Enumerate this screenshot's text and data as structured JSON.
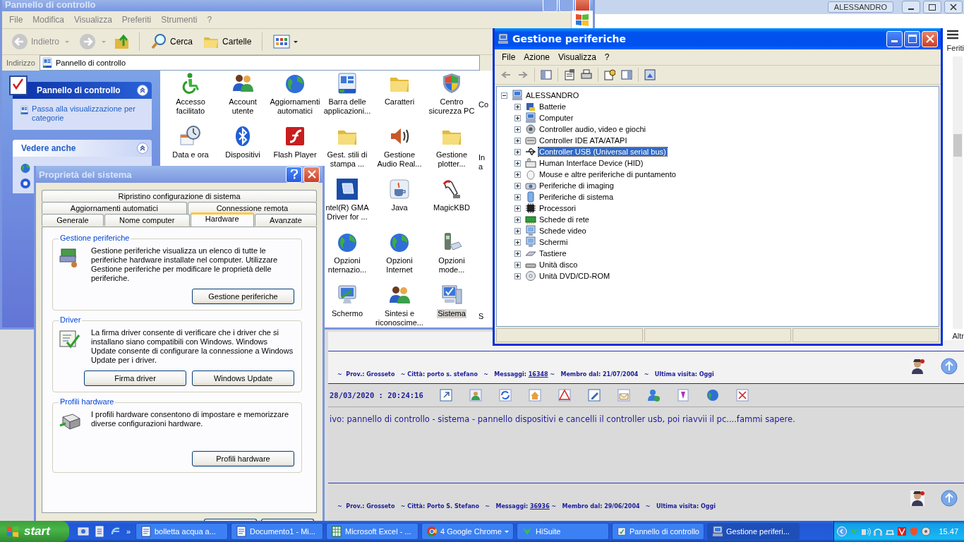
{
  "browser": {
    "user": "ALESSANDRO",
    "side_label": "Feriti",
    "side_label_bottom": "Altr"
  },
  "control_panel": {
    "title": "Pannello di controllo",
    "menu": [
      "File",
      "Modifica",
      "Visualizza",
      "Preferiti",
      "Strumenti",
      "?"
    ],
    "back": {
      "label": "Indietro",
      "disabled": true
    },
    "forward": {
      "disabled": true
    },
    "search": "Cerca",
    "folders": "Cartelle",
    "address": {
      "label": "Indirizzo",
      "value": "Pannello di controllo"
    },
    "task_panels": [
      {
        "title": "Pannello di controllo",
        "kind": "primary",
        "expanded": true,
        "links": [
          "Passa alla visualizzazione per categorie"
        ]
      },
      {
        "title": "Vedere anche",
        "kind": "secondary",
        "expanded": true
      }
    ],
    "icon_rows": [
      [
        {
          "kind": "icon",
          "label": "Accesso facilitato",
          "selected": false
        },
        {
          "kind": "icon",
          "label": "Account utente",
          "selected": false
        },
        {
          "kind": "icon",
          "label": "Aggiornamenti automatici",
          "selected": false
        },
        {
          "kind": "icon",
          "label": "Barra delle applicazioni...",
          "selected": false
        },
        {
          "kind": "icon",
          "label": "Caratteri",
          "selected": false
        },
        {
          "kind": "icon",
          "label": "Centro sicurezza PC",
          "selected": false
        },
        {
          "kind": "partial",
          "label": "Co",
          "selected": false
        }
      ],
      [
        {
          "kind": "icon",
          "label": "Data e ora",
          "selected": false
        },
        {
          "kind": "icon",
          "label": "Dispositivi",
          "selected": false
        },
        {
          "kind": "icon",
          "label": "Flash Player",
          "selected": false
        },
        {
          "kind": "icon",
          "label": "Gest. stili di stampa ...",
          "selected": false
        },
        {
          "kind": "icon",
          "label": "Gestione Audio Real...",
          "selected": false
        },
        {
          "kind": "icon",
          "label": "Gestione plotter...",
          "selected": false
        },
        {
          "kind": "partial",
          "label": "In a",
          "selected": false
        }
      ],
      [
        {
          "kind": "icon",
          "label": "ntel(R) GMA Driver for ...",
          "selected": false
        },
        {
          "kind": "icon",
          "label": "Java",
          "selected": false
        },
        {
          "kind": "icon",
          "label": "MagicKBD",
          "selected": false
        }
      ],
      [
        {
          "kind": "icon",
          "label": "Opzioni nternazio...",
          "selected": false
        },
        {
          "kind": "icon",
          "label": "Opzioni Internet",
          "selected": false
        },
        {
          "kind": "icon",
          "label": "Opzioni mode...",
          "selected": false
        }
      ],
      [
        {
          "kind": "icon",
          "label": "Schermo",
          "selected": false
        },
        {
          "kind": "icon",
          "label": "Sintesi e riconoscime...",
          "selected": false
        },
        {
          "kind": "icon",
          "label": "Sistema",
          "selected": true
        },
        {
          "kind": "partial",
          "label": "S",
          "selected": false
        }
      ]
    ]
  },
  "system_properties": {
    "title": "Proprietà del sistema",
    "tab_rows": [
      [
        {
          "label": "Ripristino configurazione di sistema",
          "selected": false
        }
      ],
      [
        {
          "label": "Aggiornamenti automatici",
          "selected": false
        },
        {
          "label": "Connessione remota",
          "selected": false
        }
      ],
      [
        {
          "label": "Generale",
          "selected": false
        },
        {
          "label": "Nome computer",
          "selected": false
        },
        {
          "label": "Hardware",
          "selected": true
        },
        {
          "label": "Avanzate",
          "selected": false
        }
      ]
    ],
    "groups": [
      {
        "kind": "devices",
        "title": "Gestione periferiche",
        "text": "Gestione periferiche visualizza un elenco di tutte le periferiche hardware installate nel computer. Utilizzare Gestione periferiche per modificare le proprietà delle periferiche.",
        "buttons": [
          "Gestione periferiche"
        ]
      },
      {
        "kind": "driver",
        "title": "Driver",
        "text": "La firma driver consente di verificare che i driver che si installano siano compatibili con Windows. Windows Update consente di configurare la connessione a Windows Update per i driver.",
        "buttons": [
          "Firma driver",
          "Windows Update"
        ]
      },
      {
        "kind": "profiles",
        "title": "Profili hardware",
        "text": "I profili hardware consentono di impostare e memorizzare diverse configurazioni hardware.",
        "buttons": [
          "Profili hardware"
        ]
      }
    ]
  },
  "device_manager": {
    "title": "Gestione periferiche",
    "menu": [
      "File",
      "Azione",
      "Visualizza",
      "?"
    ],
    "tree": {
      "label": "ALESSANDRO",
      "expanded": true,
      "children": [
        {
          "label": "Batterie",
          "expanded": false,
          "selected": false
        },
        {
          "label": "Computer",
          "expanded": false,
          "selected": false
        },
        {
          "label": "Controller audio, video e giochi",
          "expanded": false,
          "selected": false
        },
        {
          "label": "Controller IDE ATA/ATAPI",
          "expanded": false,
          "selected": false
        },
        {
          "label": "Controller USB (Universal serial bus)",
          "expanded": false,
          "selected": true
        },
        {
          "label": "Human Interface Device (HID)",
          "expanded": false,
          "selected": false
        },
        {
          "label": "Mouse e altre periferiche di puntamento",
          "expanded": false,
          "selected": false
        },
        {
          "label": "Periferiche di imaging",
          "expanded": false,
          "selected": false
        },
        {
          "label": "Periferiche di sistema",
          "expanded": false,
          "selected": false
        },
        {
          "label": "Processori",
          "expanded": false,
          "selected": false
        },
        {
          "label": "Schede di rete",
          "expanded": false,
          "selected": false
        },
        {
          "label": "Schede video",
          "expanded": false,
          "selected": false
        },
        {
          "label": "Schermi",
          "expanded": false,
          "selected": false
        },
        {
          "label": "Tastiere",
          "expanded": false,
          "selected": false
        },
        {
          "label": "Unità disco",
          "expanded": false,
          "selected": false
        },
        {
          "label": "Unità DVD/CD-ROM",
          "expanded": false,
          "selected": false
        }
      ]
    }
  },
  "forum": {
    "profile_lines": [
      {
        "before": "~  Prov.: Grosseto   ~ Città: porto s. stefano   ~   Messaggi:",
        "count": "16348",
        "after": "~   Membro dal: 21/07/2004   ~   Ultima visita: Oggi"
      },
      {
        "before": "~  Prov.: Grosseto   ~ Città: Porto S. Stefano   ~   Messaggi:",
        "count": "36936",
        "after": "~   Membro dal: 29/06/2004   ~   Ultima visita: Oggi"
      }
    ],
    "date": "28/03/2020 : 20:24:16",
    "message": "ivo: pannello di controllo - sistema - pannello dispositivi e cancelli il controller usb, poi riavvii il pc....fammi sapere."
  },
  "taskbar": {
    "start": "start",
    "more": "»",
    "tasks": [
      {
        "kind": "document",
        "label": "bolletta acqua a...",
        "selected": false
      },
      {
        "kind": "document",
        "label": "Documento1 - Mi...",
        "selected": false
      },
      {
        "kind": "spreadsheet",
        "label": "Microsoft Excel - ...",
        "selected": false
      },
      {
        "kind": "browser",
        "label": "4 Google Chrome",
        "selected": false
      },
      {
        "kind": "app",
        "label": "HiSuite",
        "selected": false
      },
      {
        "kind": "control",
        "label": "Pannello di controllo",
        "selected": false
      },
      {
        "kind": "computer",
        "label": "Gestione periferi...",
        "selected": true
      }
    ],
    "clock": "15.47"
  }
}
